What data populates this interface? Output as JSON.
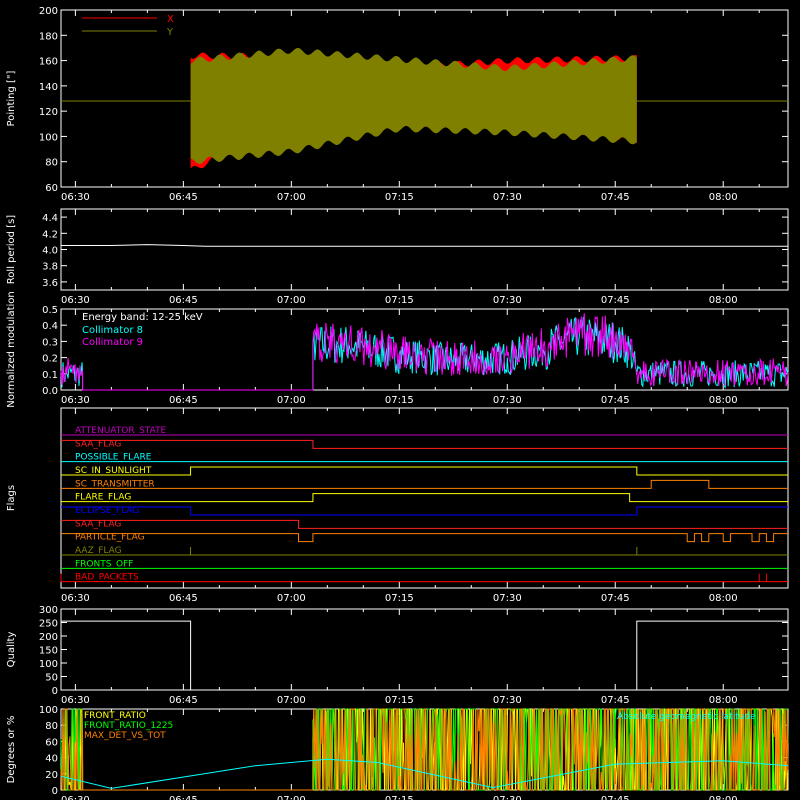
{
  "colors": {
    "background": "#000000",
    "axis": "#ffffff",
    "x_red": "#ff0000",
    "y_olive": "#808000",
    "cyan": "#00ffff",
    "magenta": "#ff00ff",
    "yellow": "#ffff00",
    "green": "#00ff00",
    "orange": "#ff8000",
    "blue": "#0000ff",
    "purple": "#c000c0",
    "white": "#ffffff"
  },
  "time_ticks": [
    "06:30",
    "06:45",
    "07:00",
    "07:15",
    "07:30",
    "07:45",
    "08:00"
  ],
  "chart_data": [
    {
      "id": "pointing",
      "type": "line",
      "ylabel": "Pointing [\"]",
      "ylim": [
        60,
        200
      ],
      "yticks": [
        "60",
        "80",
        "100",
        "120",
        "140",
        "160",
        "180",
        "200"
      ],
      "xlim": [
        "06:28",
        "08:09"
      ],
      "legend_position": "top-left",
      "series": [
        {
          "name": "X",
          "color": "#ff0000",
          "baseline": 128,
          "oscillation_envelope": [
            {
              "t": "06:46",
              "min": 73,
              "max": 164
            },
            {
              "t": "07:00",
              "min": 110,
              "max": 163
            },
            {
              "t": "07:15",
              "min": 117,
              "max": 154
            },
            {
              "t": "07:30",
              "min": 110,
              "max": 160
            },
            {
              "t": "07:48",
              "min": 97,
              "max": 162
            }
          ]
        },
        {
          "name": "Y",
          "color": "#808000",
          "baseline": 128,
          "oscillation_envelope": [
            {
              "t": "06:46",
              "min": 80,
              "max": 160
            },
            {
              "t": "07:00",
              "min": 88,
              "max": 168
            },
            {
              "t": "07:15",
              "min": 106,
              "max": 161
            },
            {
              "t": "07:30",
              "min": 103,
              "max": 154
            },
            {
              "t": "07:48",
              "min": 96,
              "max": 162
            }
          ]
        }
      ]
    },
    {
      "id": "roll_period",
      "type": "line",
      "ylabel": "Roll period [s]",
      "ylim": [
        3.5,
        4.5
      ],
      "yticks": [
        "3.6",
        "3.8",
        "4.0",
        "4.2",
        "4.4"
      ],
      "series": [
        {
          "name": "",
          "color": "#ffffff",
          "x": [
            "06:28",
            "06:35",
            "06:40",
            "06:45",
            "06:48",
            "07:00",
            "07:30",
            "08:09"
          ],
          "y": [
            4.05,
            4.05,
            4.06,
            4.05,
            4.04,
            4.04,
            4.04,
            4.04
          ]
        }
      ]
    },
    {
      "id": "modulation",
      "type": "line",
      "ylabel": "Normalized modulation",
      "ylim": [
        0,
        0.5
      ],
      "yticks": [
        "0.0",
        "0.1",
        "0.2",
        "0.3",
        "0.4",
        "0.5"
      ],
      "annotation": "Energy band: 12-25 keV",
      "series": [
        {
          "name": "Collimator 8",
          "color": "#00ffff",
          "x": [
            "06:28",
            "06:31",
            "06:31",
            "07:03",
            "07:03",
            "07:08",
            "07:15",
            "07:22",
            "07:30",
            "07:35",
            "07:40",
            "07:45",
            "07:47",
            "07:48",
            "08:00",
            "08:09"
          ],
          "y": [
            0.1,
            0.1,
            0.0,
            0.0,
            0.28,
            0.28,
            0.22,
            0.18,
            0.2,
            0.25,
            0.33,
            0.3,
            0.25,
            0.1,
            0.1,
            0.1
          ]
        },
        {
          "name": "Collimator 9",
          "color": "#ff00ff",
          "x": [
            "06:28",
            "06:31",
            "06:31",
            "07:03",
            "07:03",
            "07:08",
            "07:15",
            "07:22",
            "07:30",
            "07:35",
            "07:40",
            "07:45",
            "07:47",
            "07:48",
            "08:00",
            "08:09"
          ],
          "y": [
            0.12,
            0.12,
            0.0,
            0.0,
            0.3,
            0.29,
            0.23,
            0.19,
            0.21,
            0.27,
            0.35,
            0.31,
            0.26,
            0.11,
            0.11,
            0.11
          ]
        }
      ]
    },
    {
      "id": "flags",
      "type": "line",
      "ylabel": "Flags",
      "series": [
        {
          "name": "ATTENUATOR_STATE",
          "color": "#c000c0",
          "steps": [
            [
              "06:28",
              0
            ],
            [
              "08:09",
              0
            ]
          ]
        },
        {
          "name": "SAA_FLAG",
          "color": "#ff2020",
          "steps": [
            [
              "06:28",
              1
            ],
            [
              "07:03",
              0
            ],
            [
              "08:09",
              0
            ]
          ]
        },
        {
          "name": "POSSIBLE_FLARE",
          "color": "#00ffff",
          "steps": [
            [
              "06:28",
              0
            ],
            [
              "08:09",
              0
            ]
          ]
        },
        {
          "name": "SC_IN_SUNLIGHT",
          "color": "#ffff00",
          "steps": [
            [
              "06:28",
              0
            ],
            [
              "06:46",
              1
            ],
            [
              "07:48",
              0
            ],
            [
              "08:09",
              0
            ]
          ]
        },
        {
          "name": "SC_TRANSMITTER",
          "color": "#ff8000",
          "steps": [
            [
              "06:28",
              0
            ],
            [
              "07:50",
              1
            ],
            [
              "07:58",
              0
            ],
            [
              "08:09",
              0
            ]
          ]
        },
        {
          "name": "FLARE_FLAG",
          "color": "#ffff00",
          "steps": [
            [
              "06:28",
              0
            ],
            [
              "07:03",
              1
            ],
            [
              "07:47",
              0
            ],
            [
              "08:09",
              0
            ]
          ]
        },
        {
          "name": "ECLIPSE_FLAG",
          "color": "#0000ff",
          "steps": [
            [
              "06:28",
              1
            ],
            [
              "06:46",
              0
            ],
            [
              "07:48",
              1
            ],
            [
              "08:09",
              1
            ]
          ]
        },
        {
          "name": "SAA_FLAG",
          "color": "#ff2020",
          "steps": [
            [
              "06:28",
              1
            ],
            [
              "07:01",
              0
            ],
            [
              "08:09",
              0
            ]
          ]
        },
        {
          "name": "PARTICLE_FLAG",
          "color": "#ff8000",
          "steps": [
            [
              "06:28",
              1
            ],
            [
              "07:01",
              0
            ],
            [
              "07:03",
              1
            ],
            [
              "07:55",
              0
            ],
            [
              "07:56",
              1
            ],
            [
              "07:57",
              0
            ],
            [
              "07:58",
              1
            ],
            [
              "08:00",
              0
            ],
            [
              "08:01",
              1
            ],
            [
              "08:04",
              0
            ],
            [
              "08:05",
              1
            ],
            [
              "08:06",
              0
            ],
            [
              "08:07",
              1
            ],
            [
              "08:09",
              1
            ]
          ]
        },
        {
          "name": "AAZ_FLAG",
          "color": "#808000",
          "steps": [
            [
              "06:28",
              0
            ],
            [
              "06:46",
              1
            ],
            [
              "06:46",
              0
            ],
            [
              "07:48",
              1
            ],
            [
              "07:48",
              0
            ],
            [
              "08:09",
              0
            ]
          ]
        },
        {
          "name": "FRONTS_OFF",
          "color": "#00ff00",
          "steps": [
            [
              "06:28",
              0
            ],
            [
              "08:09",
              0
            ]
          ]
        },
        {
          "name": "BAD_PACKETS",
          "color": "#ff0000",
          "steps": [
            [
              "06:28",
              1
            ],
            [
              "06:28",
              0
            ],
            [
              "08:05",
              1
            ],
            [
              "08:05",
              0
            ],
            [
              "08:06",
              1
            ],
            [
              "08:06",
              0
            ],
            [
              "08:09",
              0
            ]
          ]
        }
      ]
    },
    {
      "id": "quality",
      "type": "line",
      "ylabel": "Quality",
      "ylim": [
        0,
        300
      ],
      "yticks": [
        "0",
        "50",
        "100",
        "150",
        "200",
        "250",
        "300"
      ],
      "series": [
        {
          "name": "",
          "color": "#ffffff",
          "x": [
            "06:28",
            "06:46",
            "06:46",
            "07:48",
            "07:48",
            "08:09"
          ],
          "y": [
            255,
            255,
            0,
            0,
            255,
            255
          ]
        }
      ]
    },
    {
      "id": "ratios",
      "type": "line",
      "ylabel": "Degrees or %",
      "ylim": [
        0,
        100
      ],
      "yticks": [
        "0",
        "20",
        "40",
        "60",
        "80",
        "100"
      ],
      "series": [
        {
          "name": "FRONT_RATIO",
          "color": "#ffff00",
          "x": [
            "06:28",
            "06:31",
            "06:31",
            "07:03",
            "07:03",
            "07:06",
            "07:06",
            "07:45",
            "07:45",
            "07:51",
            "07:51",
            "08:00",
            "08:00",
            "08:09"
          ],
          "y": [
            30,
            30,
            0,
            0,
            63,
            63,
            48,
            48,
            63,
            63,
            50,
            50,
            36,
            36
          ]
        },
        {
          "name": "FRONT_RATIO_1225",
          "color": "#00ff00",
          "x": [
            "06:28",
            "06:31",
            "06:31",
            "07:03",
            "07:03",
            "07:06",
            "07:06",
            "07:45",
            "07:45",
            "07:51",
            "07:51",
            "08:00",
            "08:00",
            "08:09"
          ],
          "y": [
            63,
            63,
            0,
            0,
            87,
            87,
            52,
            52,
            88,
            88,
            60,
            60,
            58,
            58
          ]
        },
        {
          "name": "MAX_DET_VS_TOT",
          "color": "#ff8000",
          "x": [
            "06:28",
            "06:31",
            "06:31",
            "07:03",
            "07:03",
            "07:30",
            "07:45",
            "08:09"
          ],
          "y": [
            25,
            25,
            0,
            0,
            25,
            24,
            27,
            25
          ]
        },
        {
          "name": "Absolute geomagnetic latitude",
          "color": "#00ffff",
          "x": [
            "06:28",
            "06:35",
            "06:55",
            "07:05",
            "07:12",
            "07:28",
            "07:45",
            "08:00",
            "08:09"
          ],
          "y": [
            17,
            2,
            30,
            38,
            34,
            3,
            32,
            36,
            30
          ]
        }
      ]
    }
  ]
}
